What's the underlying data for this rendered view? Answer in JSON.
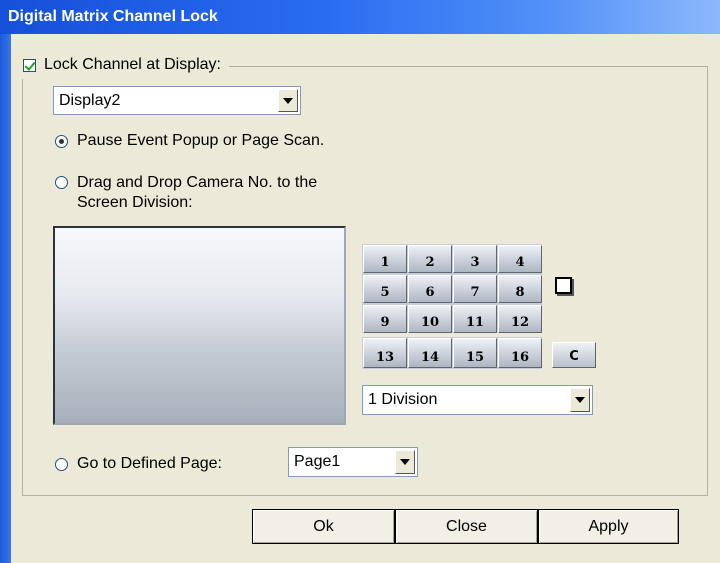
{
  "window": {
    "title": "Digital Matrix Channel Lock"
  },
  "lock_channel": {
    "label": "Lock Channel at Display:",
    "checked": true
  },
  "display_select": {
    "value": "Display2"
  },
  "options": {
    "pause_label": "Pause Event Popup or Page Scan.",
    "drag_label_line1": "Drag and Drop Camera No. to the",
    "drag_label_line2": "Screen Division:",
    "goto_label": "Go to Defined Page:",
    "selected": "pause"
  },
  "camera_buttons": [
    "1",
    "2",
    "3",
    "4",
    "5",
    "6",
    "7",
    "8",
    "9",
    "10",
    "11",
    "12"
  ],
  "camera_buttons_row4": [
    "13",
    "14",
    "15",
    "16"
  ],
  "clear_button": {
    "label": "C"
  },
  "division_select": {
    "value": "1 Division"
  },
  "page_select": {
    "value": "Page1"
  },
  "footer": {
    "ok": "Ok",
    "close": "Close",
    "apply": "Apply"
  },
  "icons": {
    "full_screen": "square-icon",
    "dropdown": "chevron-down-icon"
  }
}
